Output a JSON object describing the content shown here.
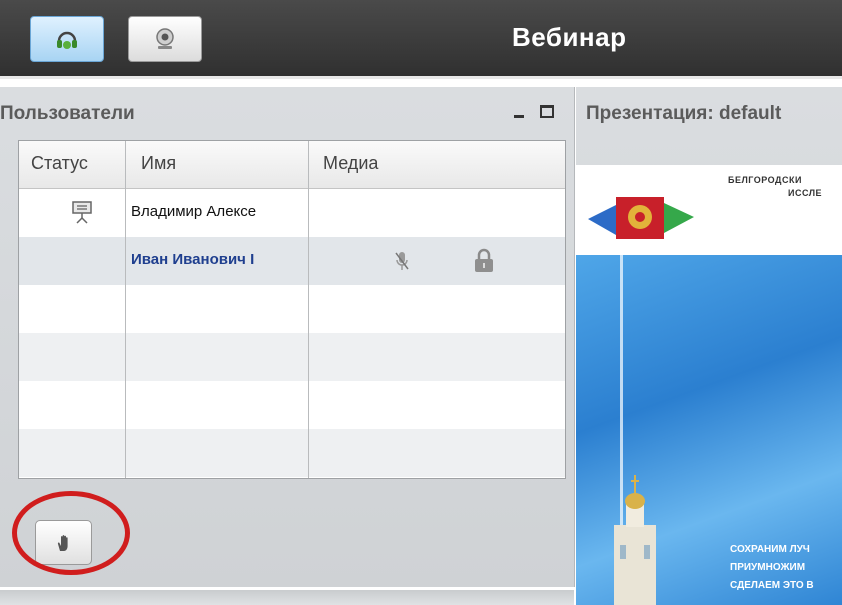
{
  "app": {
    "title": "Вебинар"
  },
  "toolbar": {
    "buttons": [
      {
        "name": "audio-headset",
        "icon": "headset-icon",
        "active": true
      },
      {
        "name": "webcam",
        "icon": "webcam-icon",
        "active": false
      }
    ]
  },
  "users_panel": {
    "title": "Пользователи",
    "columns": [
      "Статус",
      "Имя",
      "Медиа"
    ],
    "rows": [
      {
        "status_icon": "presenter-icon",
        "name": "Владимир Алексе",
        "media_icons": []
      },
      {
        "status_icon": "",
        "name": "Иван Иванович I",
        "media_icons": [
          "muted-mic-icon",
          "lock-icon"
        ]
      }
    ],
    "raise_hand_icon": "raise-hand-icon"
  },
  "presentation_panel": {
    "title": "Презентация: default",
    "slide": {
      "header_line1": "БЕЛГОРОДСКИ",
      "header_line2": "ИССЛЕ",
      "message_lines": [
        "СОХРАНИМ ЛУЧ",
        "ПРИУМНОЖИМ",
        "СДЕЛАЕМ ЭТО В"
      ]
    }
  },
  "colors": {
    "topbar": "#3a3a3a",
    "panel": "#d5d8db",
    "highlight_ring": "#d01d1d",
    "selected_user_text": "#1f3f8f"
  }
}
